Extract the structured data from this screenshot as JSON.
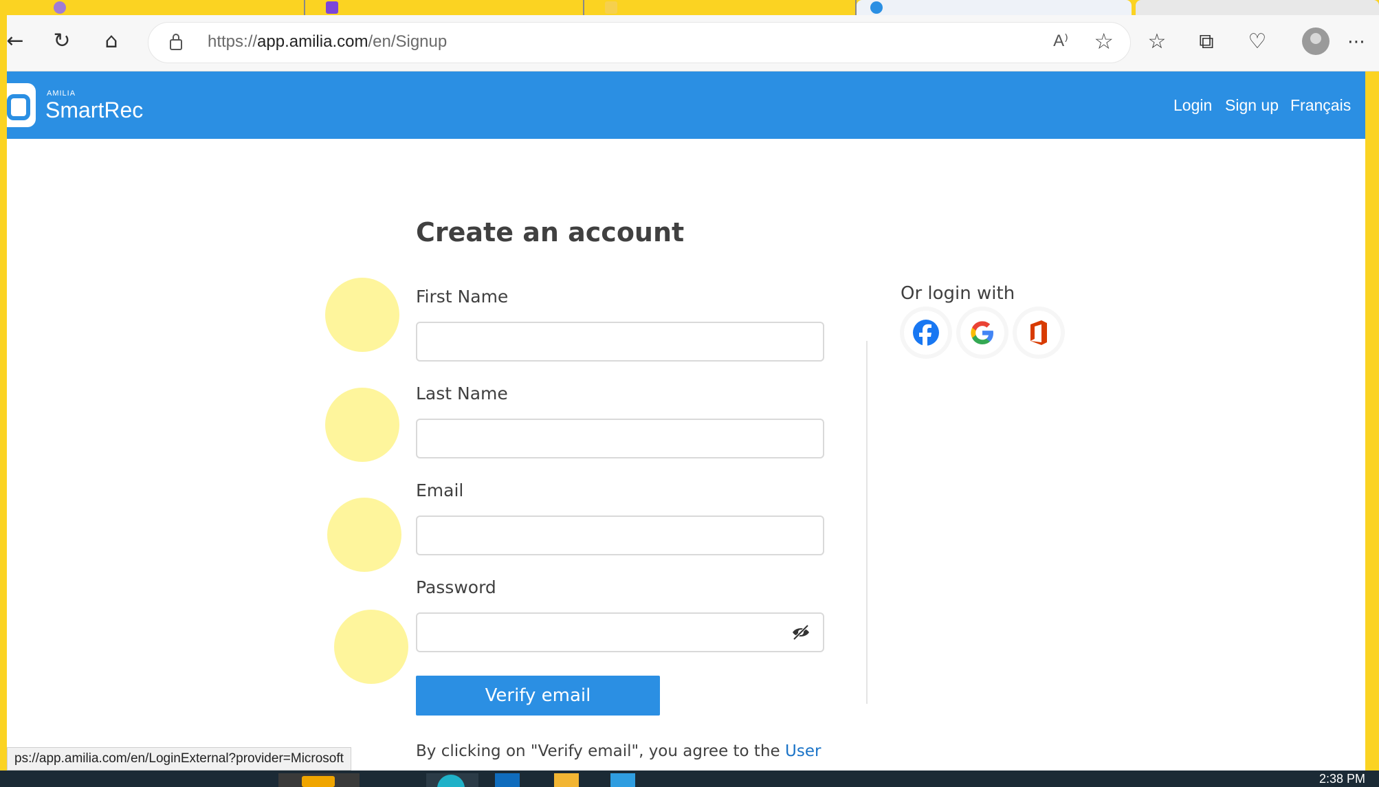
{
  "browser": {
    "url_prefix": "https://",
    "url_domain": "app.amilia.com",
    "url_path": "/en/Signup",
    "read_aloud": "A⁾"
  },
  "header": {
    "logo_small": "AMILIA",
    "logo_text": "SmartRec",
    "nav": {
      "login": "Login",
      "signup": "Sign up",
      "language": "Français"
    }
  },
  "form": {
    "title": "Create an account",
    "first_name_label": "First Name",
    "last_name_label": "Last Name",
    "email_label": "Email",
    "password_label": "Password",
    "first_name_value": "",
    "last_name_value": "",
    "email_value": "",
    "password_value": "",
    "verify_button": "Verify email",
    "terms_text": "By clicking on \"Verify email\", you agree to the ",
    "terms_link": "User"
  },
  "social": {
    "heading": "Or login with",
    "providers": [
      "facebook-icon",
      "google-icon",
      "office-icon"
    ]
  },
  "status_bar": {
    "text": "ps://app.amilia.com/en/LoginExternal?provider=Microsoft"
  },
  "taskbar": {
    "clock": "2:38 PM"
  },
  "colors": {
    "brand_blue": "#2b8fe3",
    "frame_yellow": "#fbd322",
    "highlight_yellow": "#fef59c"
  }
}
